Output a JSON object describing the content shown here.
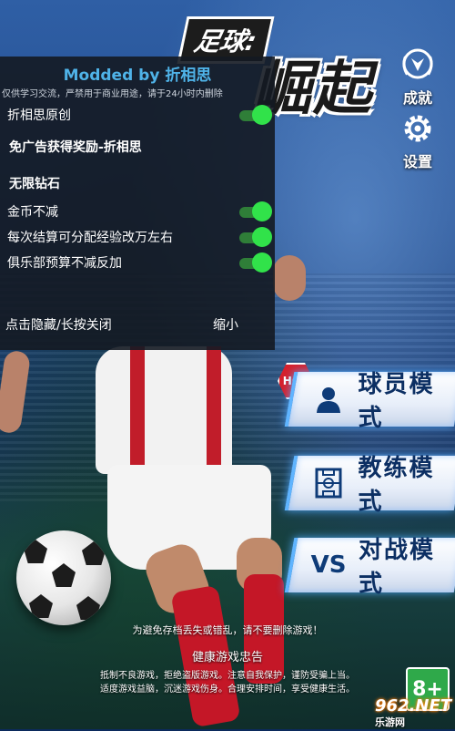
{
  "logo": {
    "small_text": "足球:",
    "big_text": "崛起"
  },
  "side": {
    "achievements_label": "成就",
    "settings_label": "设置"
  },
  "modes": [
    {
      "icon": "player-icon",
      "label": "球员模式",
      "badge": "HOT"
    },
    {
      "icon": "coach-icon",
      "label": "教练模式"
    },
    {
      "icon": "versus-icon",
      "label": "对战模式",
      "icon_text": "VS"
    }
  ],
  "notices": {
    "warning": "为避免存档丢失或错乱，请不要删除游戏！",
    "health_title": "健康游戏忠告",
    "health_line1": "抵制不良游戏，拒绝盗版游戏。注意自我保护，谨防受骗上当。",
    "health_line2": "适度游戏益脑，沉迷游戏伤身。合理安排时间，享受健康生活。"
  },
  "age_rating": "8+",
  "watermark": {
    "brand": "962.NET",
    "sub": "乐游网"
  },
  "mod_menu": {
    "title": "Modded by 折相思",
    "subtitle": "仅供学习交流，严禁用于商业用途，请于24小时内删除",
    "items": [
      {
        "label": "折相思原创",
        "toggle": true
      },
      {
        "label": "免广告获得奖励-折相思",
        "toggle": false
      },
      {
        "label": "无限钻石",
        "toggle": false
      },
      {
        "label": "金币不减",
        "toggle": true
      },
      {
        "label": "每次结算可分配经验改万左右",
        "toggle": true
      },
      {
        "label": "俱乐部预算不减反加",
        "toggle": true
      }
    ],
    "hide_label": "点击隐藏/长按关闭",
    "minimize_label": "缩小"
  }
}
